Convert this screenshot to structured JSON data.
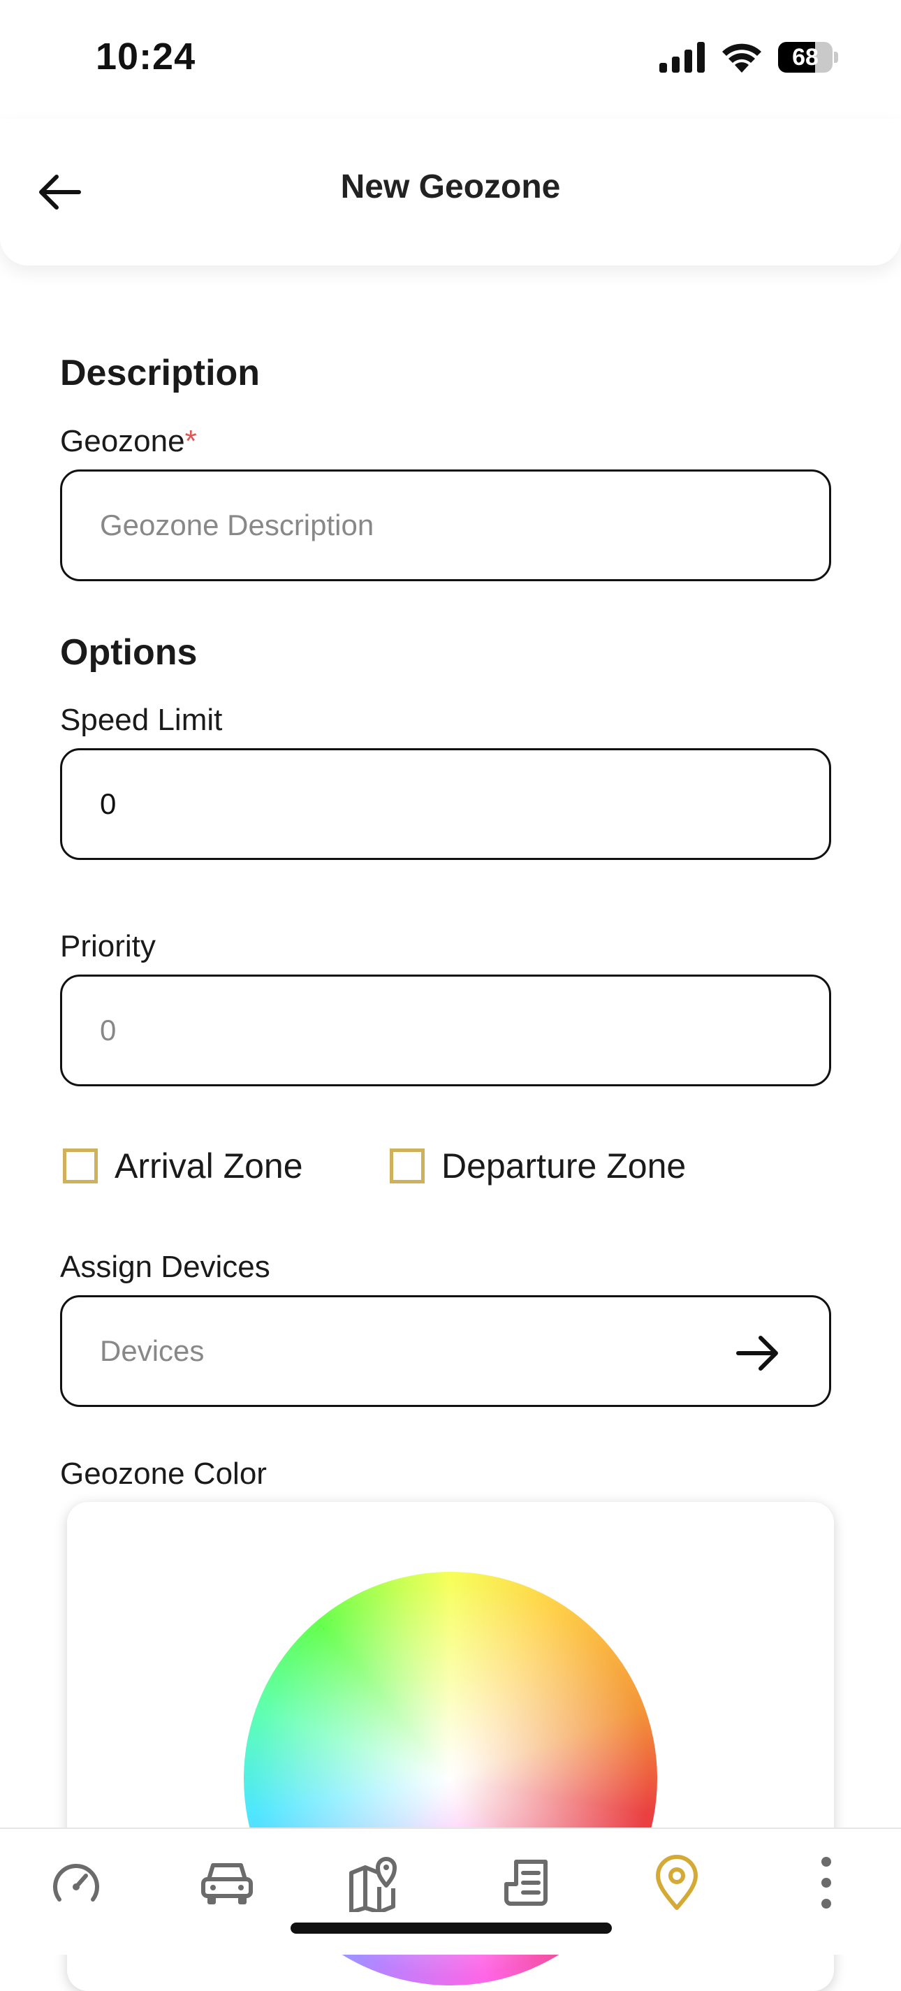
{
  "status_bar": {
    "time": "10:24",
    "battery_percent": "68",
    "battery_level": 0.68
  },
  "header": {
    "title": "New Geozone"
  },
  "sections": {
    "description": "Description",
    "options": "Options"
  },
  "fields": {
    "geozone": {
      "label": "Geozone",
      "required_mark": "*",
      "placeholder": "Geozone Description"
    },
    "speed_limit": {
      "label": "Speed Limit",
      "value": "0"
    },
    "priority": {
      "label": "Priority",
      "placeholder": "0"
    },
    "arrival_zone": {
      "label": "Arrival Zone",
      "checked": false
    },
    "departure_zone": {
      "label": "Departure Zone",
      "checked": false
    },
    "assign_devices": {
      "label": "Assign Devices",
      "placeholder": "Devices"
    },
    "geozone_color": {
      "label": "Geozone Color"
    }
  },
  "bottom_nav": {
    "items": [
      {
        "icon": "speedometer-icon"
      },
      {
        "icon": "car-icon"
      },
      {
        "icon": "map-pin-icon"
      },
      {
        "icon": "report-icon"
      },
      {
        "icon": "location-pin-icon",
        "active": true
      },
      {
        "icon": "more-vertical-icon"
      }
    ],
    "active_color": "#d4a936",
    "inactive_color": "#6b6b6b"
  },
  "colors": {
    "checkbox_border": "#cfb15c",
    "required": "#e05555"
  }
}
